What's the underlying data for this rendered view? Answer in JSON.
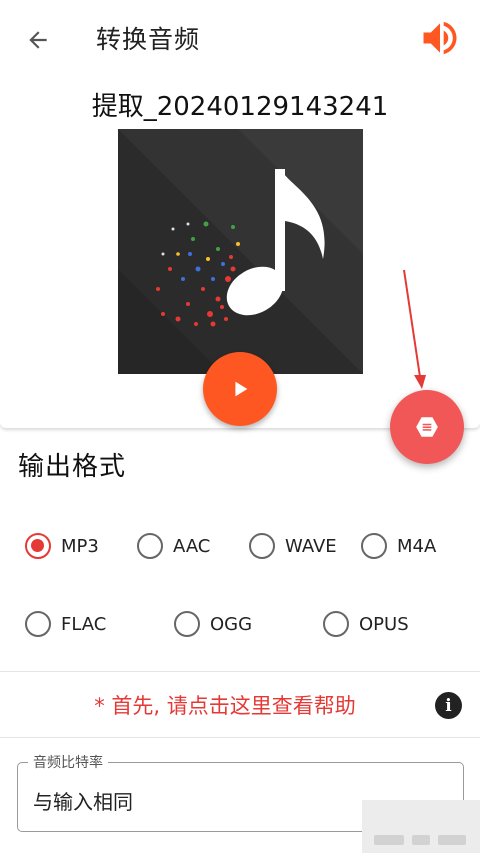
{
  "appbar": {
    "title": "转换音频",
    "back_icon": "arrow-back-icon",
    "speaker_icon": "volume-up-icon",
    "accent": "#ff5722"
  },
  "file": {
    "name": "提取_20240129143241"
  },
  "player": {
    "play_icon": "play-icon",
    "play_color": "#ff5722"
  },
  "fab": {
    "icon": "hexagon-menu-icon",
    "color": "#f25757"
  },
  "output_format": {
    "title": "输出格式",
    "options": [
      {
        "label": "MP3",
        "checked": true
      },
      {
        "label": "AAC",
        "checked": false
      },
      {
        "label": "WAVE",
        "checked": false
      },
      {
        "label": "M4A",
        "checked": false
      },
      {
        "label": "FLAC",
        "checked": false
      },
      {
        "label": "OGG",
        "checked": false
      },
      {
        "label": "OPUS",
        "checked": false
      }
    ],
    "selected": "MP3",
    "selected_color": "#e53935"
  },
  "help": {
    "text": "* 首先, 请点击这里查看帮助",
    "info_icon": "info-icon",
    "color": "#e53935"
  },
  "bitrate": {
    "label": "音频比特率",
    "value": "与输入相同"
  }
}
